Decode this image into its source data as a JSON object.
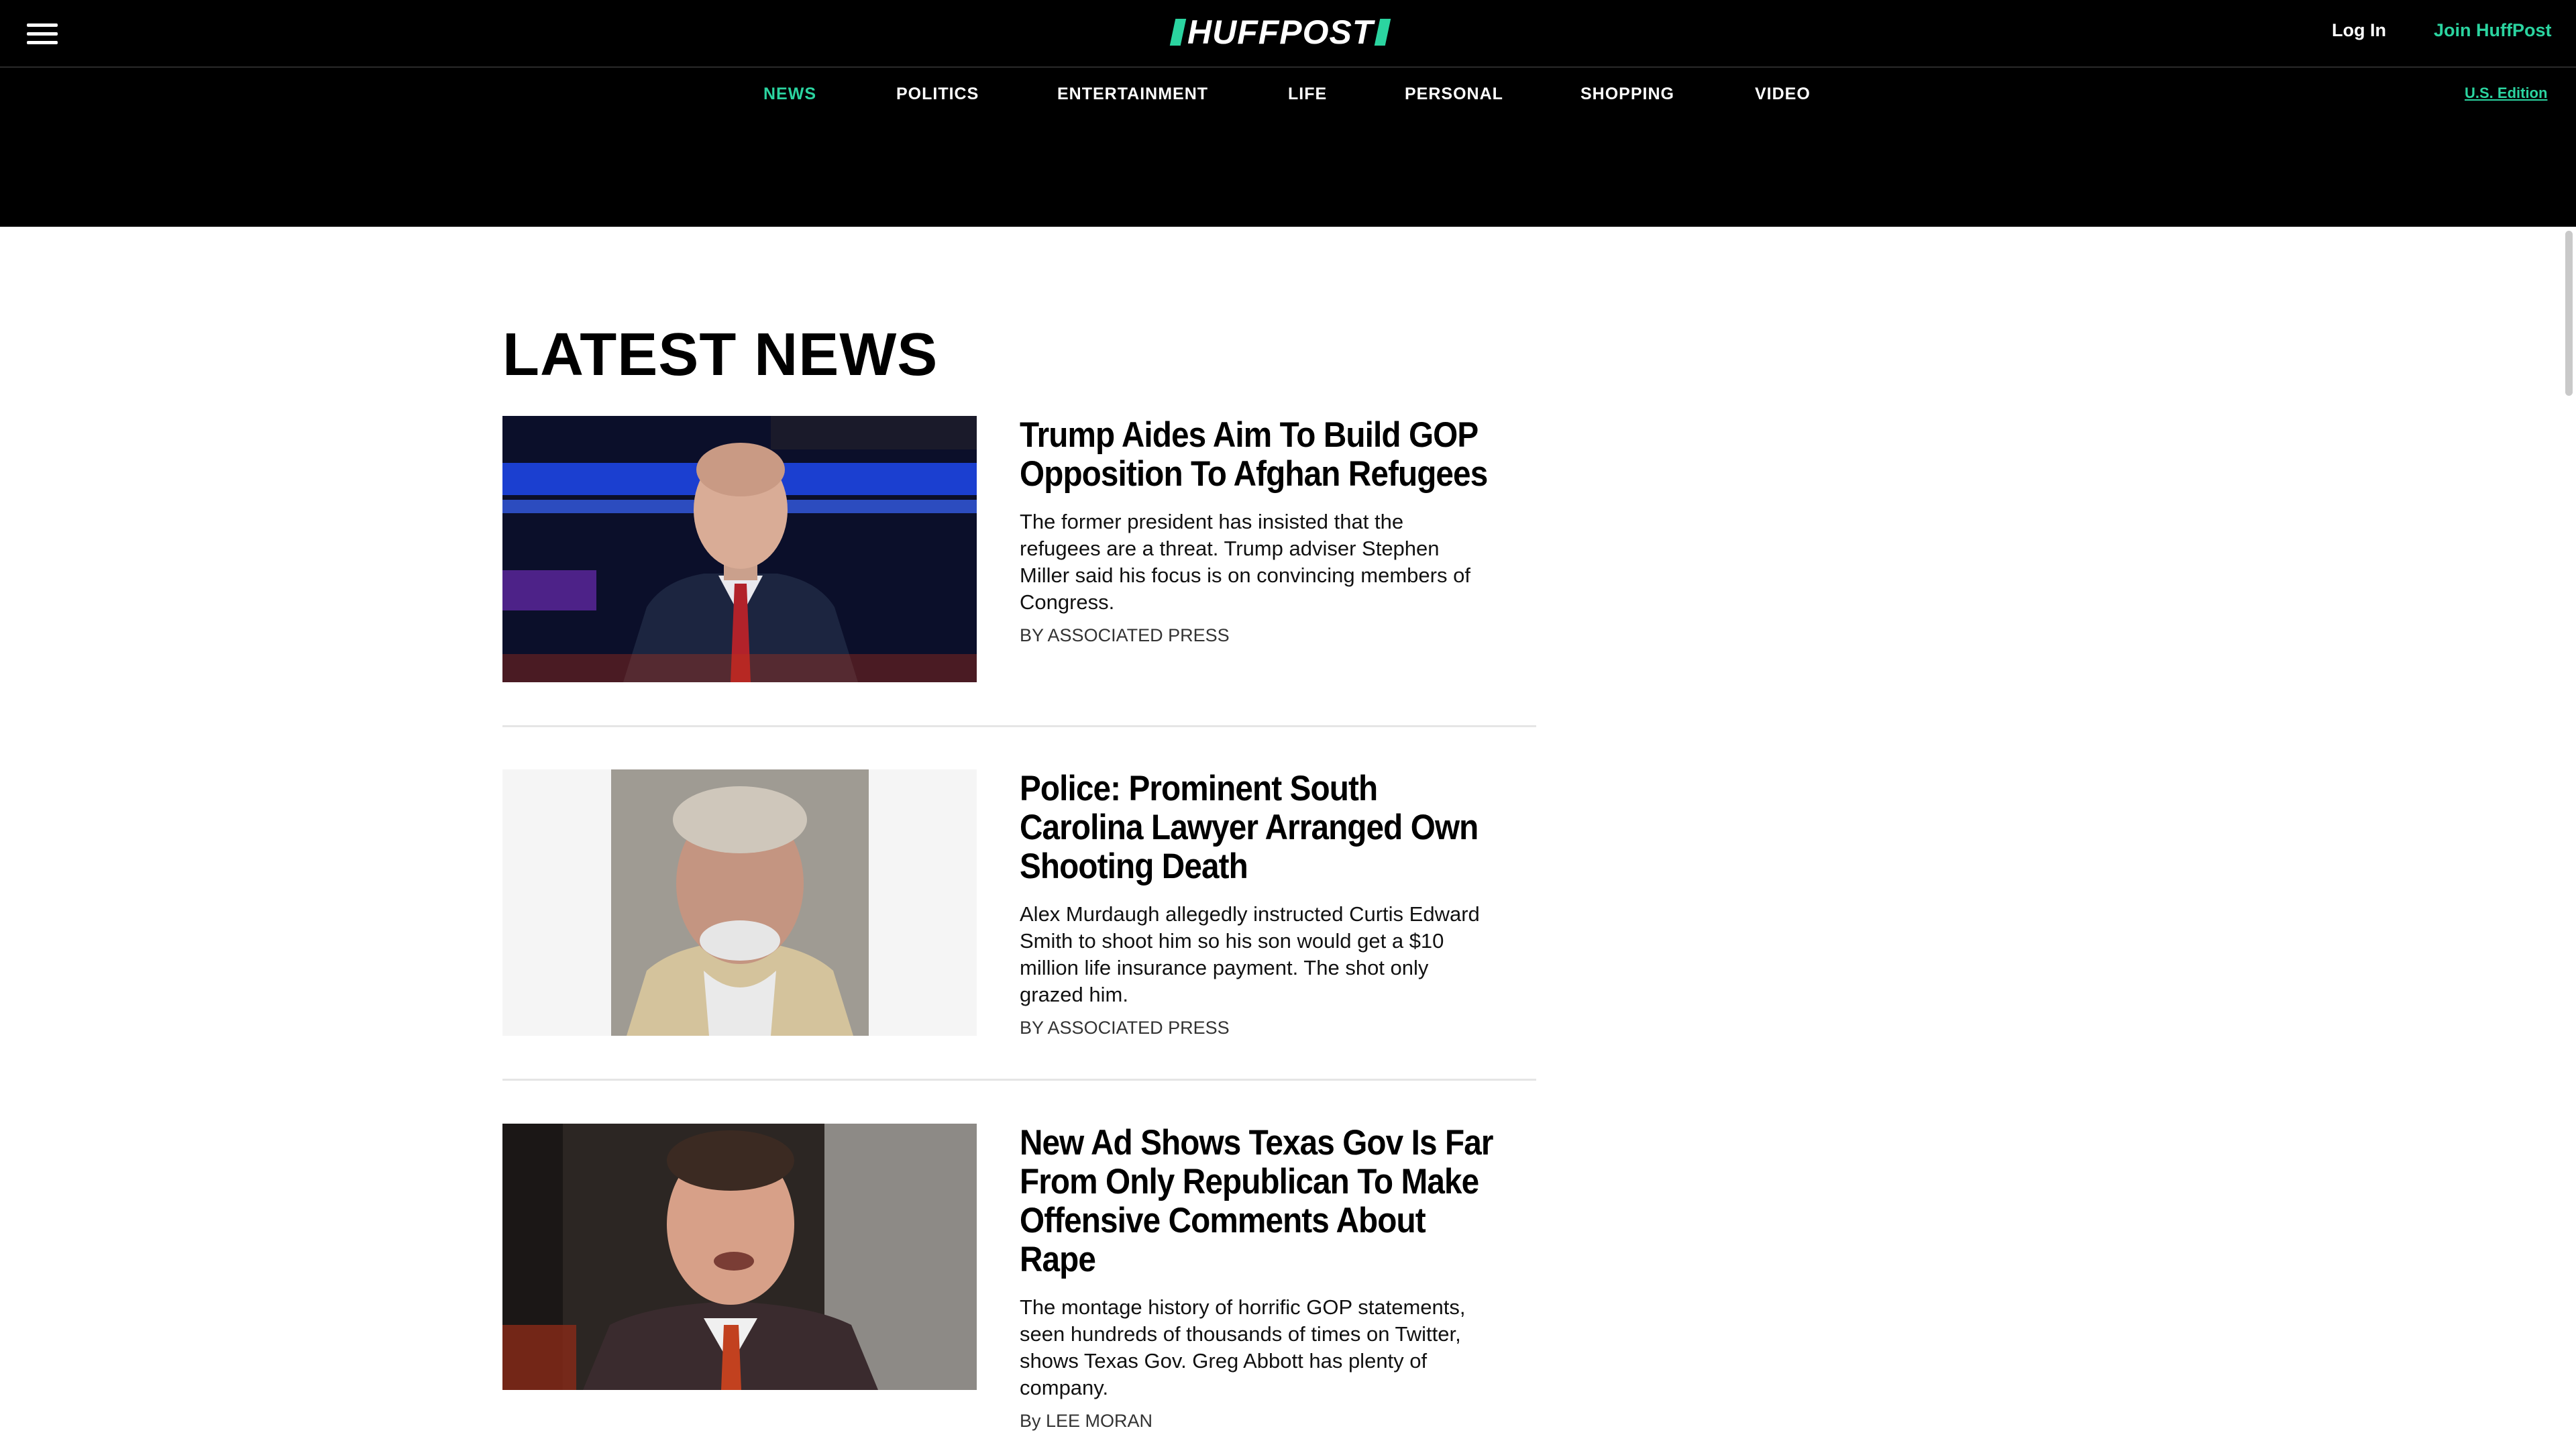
{
  "header": {
    "logo_text": "HUFFPOST",
    "login_label": "Log In",
    "join_label": "Join HuffPost",
    "edition_label": "U.S. Edition",
    "accent_color": "#2bd4a0"
  },
  "nav": {
    "items": [
      "NEWS",
      "POLITICS",
      "ENTERTAINMENT",
      "LIFE",
      "PERSONAL",
      "SHOPPING",
      "VIDEO"
    ],
    "active": "NEWS"
  },
  "main": {
    "section_title": "LATEST NEWS",
    "articles": [
      {
        "headline": "Trump Aides Aim To Build GOP Opposition To Afghan Refugees",
        "summary": "The former president has insisted that the refugees are a threat. Trump adviser Stephen Miller said his focus is on convincing members of Congress.",
        "byline": "BY ASSOCIATED PRESS",
        "image": "photo of man in suit at podium"
      },
      {
        "headline": "Police: Prominent South Carolina Lawyer Arranged Own Shooting Death",
        "summary": "Alex Murdaugh allegedly instructed Curtis Edward Smith to shoot him so his son would get a $10 million life insurance payment. The shot only grazed him.",
        "byline": "BY ASSOCIATED PRESS",
        "image": "booking photo of older man"
      },
      {
        "headline": "New Ad Shows Texas Gov Is Far From Only Republican To Make Offensive Comments About Rape",
        "summary": "The montage history of horrific GOP statements, seen hundreds of thousands of times on Twitter, shows Texas Gov. Greg Abbott has plenty of company.",
        "byline": "By LEE MORAN",
        "image": "photo of man speaking"
      }
    ]
  }
}
